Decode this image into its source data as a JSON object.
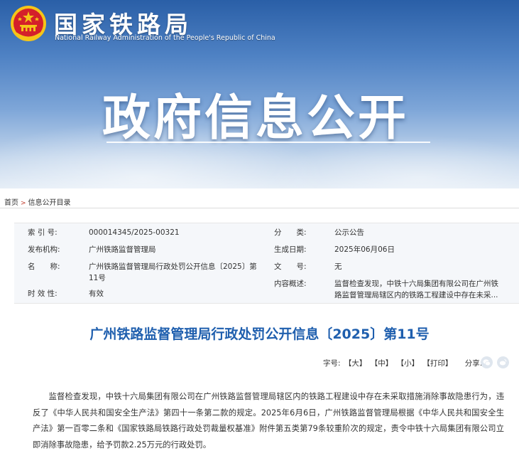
{
  "header": {
    "title_cn": "国家铁路局",
    "title_en": "National Railway Administration of the People's Republic of China",
    "banner_heading": "政府信息公开"
  },
  "breadcrumb": {
    "items": [
      "首页",
      "信息公开目录"
    ],
    "separator": ">"
  },
  "meta": {
    "index_label": "索 引 号:",
    "index_value": "000014345/2025-00321",
    "category_label": "分　　类:",
    "category_value": "公示公告",
    "publisher_label": "发布机构:",
    "publisher_value": "广州铁路监督管理局",
    "date_label": "生成日期:",
    "date_value": "2025年06月06日",
    "name_label": "名　　称:",
    "name_value": "广州铁路监督管理局行政处罚公开信息〔2025〕第11号",
    "docno_label": "文　　号:",
    "docno_value": "无",
    "summary_label": "内容概述:",
    "summary_value": "监督检查发现，中铁十六局集团有限公司在广州铁路监督管理局辖区内的铁路工程建设中存在未采...",
    "validity_label": "时 效 性:",
    "validity_value": "有效"
  },
  "article": {
    "title": "广州铁路监督管理局行政处罚公开信息〔2025〕第11号",
    "font_label": "字号:",
    "font_large": "【大】",
    "font_medium": "【中】",
    "font_small": "【小】",
    "print": "【打印】",
    "share_label": "分享:",
    "body": "监督检查发现，中铁十六局集团有限公司在广州铁路监督管理局辖区内的铁路工程建设中存在未采取措施消除事故隐患行为，违反了《中华人民共和国安全生产法》第四十一条第二款的规定。2025年6月6日，广州铁路监督管理局根据《中华人民共和国安全生产法》第一百零二条和《国家铁路局铁路行政处罚裁量权基准》附件第五类第79条较重阶次的规定，责令中铁十六局集团有限公司立即消除事故隐患，给予罚款2.25万元的行政处罚。"
  },
  "colors": {
    "accent": "#1f5fae",
    "emblem_red": "#d4202a",
    "emblem_gold": "#f5c518"
  }
}
